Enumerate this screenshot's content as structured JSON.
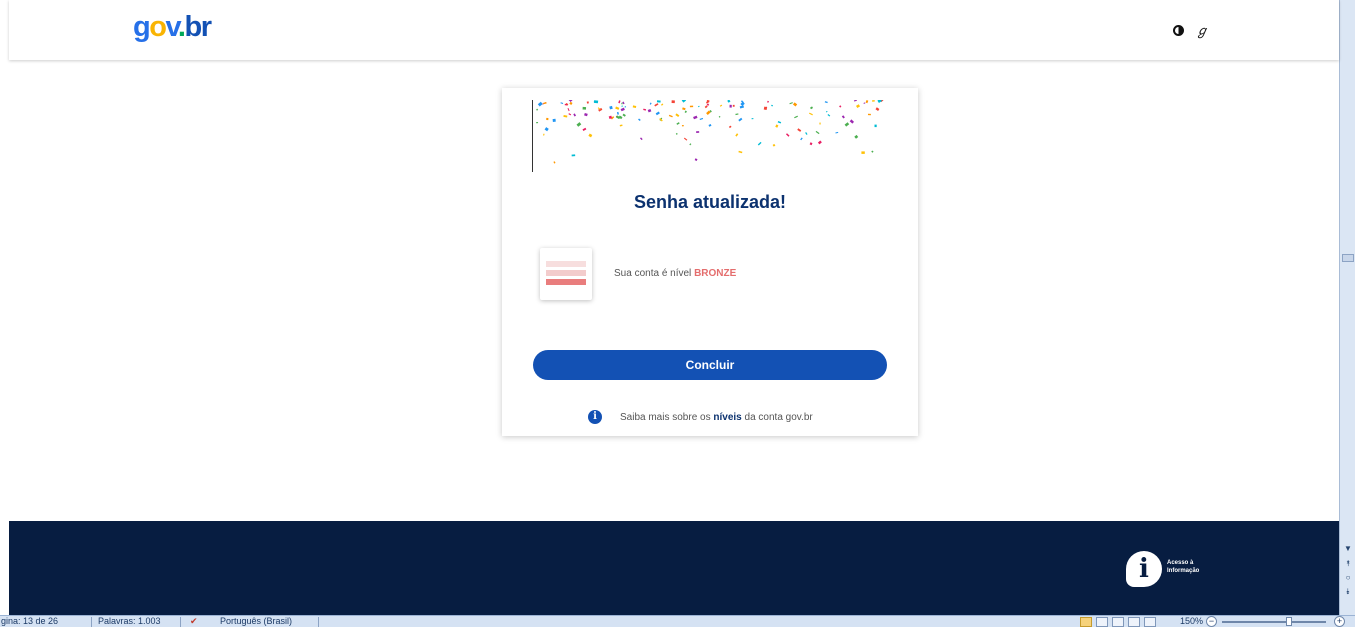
{
  "header": {
    "logo": {
      "g": "g",
      "o": "o",
      "v": "v",
      "dot": ".",
      "b": "b",
      "r": "r"
    },
    "contrast_icon": "contrast-icon",
    "libras_icon": "hand-sign-icon",
    "libras_glyph": "ℊ"
  },
  "card": {
    "title": "Senha atualizada!",
    "level_prefix": "Sua conta é nível ",
    "level_value": "BRONZE",
    "button_label": "Concluir",
    "info_prefix": "Saiba mais sobre os ",
    "info_bold": "níveis",
    "info_suffix": " da conta gov.br",
    "info_icon_glyph": "i"
  },
  "footer": {
    "ai_glyph": "i",
    "ai_line1": "Acesso à",
    "ai_line2": "Informação"
  },
  "statusbar": {
    "page": "gina: 13 de 26",
    "words": "Palavras: 1.003",
    "language": "Português (Brasil)",
    "zoom": "150%",
    "minus": "−",
    "plus": "+"
  },
  "scroll": {
    "up": "▲",
    "down": "▼",
    "prev": "⯭",
    "select": "○",
    "next": "⯯"
  },
  "colors": {
    "primary": "#1351b4",
    "footer_bg": "#071d41",
    "title": "#0c326f",
    "bronze": "#e46d6d"
  }
}
